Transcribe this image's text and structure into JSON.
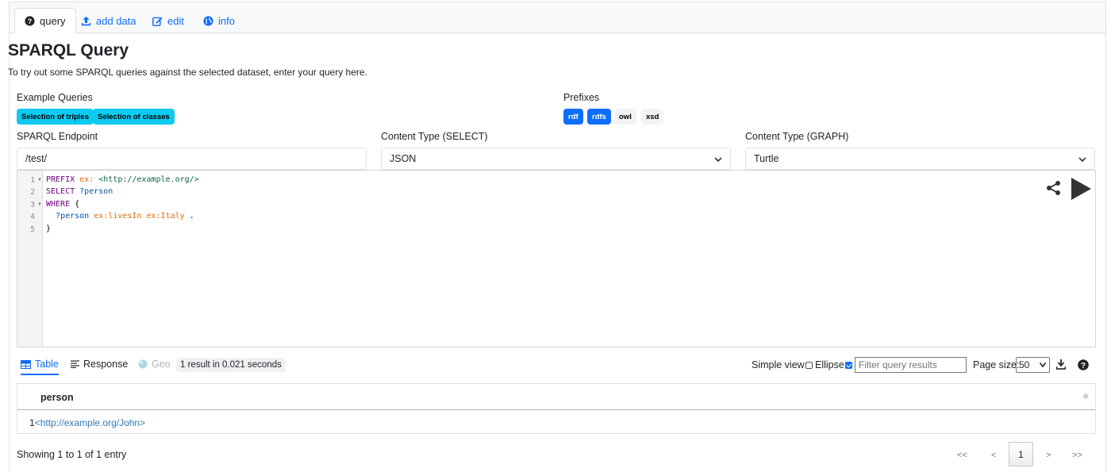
{
  "tabs": [
    {
      "label": "query",
      "icon": "question-circle-icon"
    },
    {
      "label": "add data",
      "icon": "upload-icon"
    },
    {
      "label": "edit",
      "icon": "edit-icon"
    },
    {
      "label": "info",
      "icon": "globe-icon"
    }
  ],
  "page": {
    "title": "SPARQL Query",
    "description": "To try out some SPARQL queries against the selected dataset, enter your query here."
  },
  "examples": {
    "label": "Example Queries",
    "items": [
      "Selection of triples",
      "Selection of classes"
    ]
  },
  "prefixes": {
    "label": "Prefixes",
    "items": [
      {
        "label": "rdf",
        "active": true
      },
      {
        "label": "rdfs",
        "active": true
      },
      {
        "label": "owl",
        "active": false
      },
      {
        "label": "xsd",
        "active": false
      }
    ]
  },
  "endpoint": {
    "label": "SPARQL Endpoint",
    "value": "/test/"
  },
  "content_select": {
    "label": "Content Type (SELECT)",
    "value": "JSON"
  },
  "content_graph": {
    "label": "Content Type (GRAPH)",
    "value": "Turtle"
  },
  "editor": {
    "line_numbers": [
      "1",
      "2",
      "3",
      "4",
      "5"
    ],
    "lines": [
      {
        "t1": "PREFIX",
        "t2": "ex:",
        "t3": "<http://example.org/>"
      },
      {
        "t1": "SELECT",
        "t2": "?person"
      },
      {
        "t1": "WHERE",
        "t2": "{"
      },
      {
        "t1": "?person",
        "t2": "ex:livesIn",
        "t3": "ex:Italy",
        "t4": "."
      },
      {
        "t1": "}"
      }
    ]
  },
  "results": {
    "tabs": [
      "Table",
      "Response",
      "Geo"
    ],
    "summary": "1 result in 0.021 seconds",
    "simple_view_label": "Simple view",
    "simple_view_checked": false,
    "ellipse_label": "Ellipse",
    "ellipse_checked": true,
    "filter_placeholder": "Filter query results",
    "page_size_label": "Page size:",
    "page_size_value": "50",
    "column": "person",
    "row_index": "1",
    "row_value": "<http://example.org/John>",
    "showing": "Showing 1 to 1 of 1 entry",
    "pager": {
      "first": "<<",
      "prev": "<",
      "current": "1",
      "next": ">",
      "last": ">>"
    }
  },
  "colors": {
    "primary": "#0d6efd",
    "info": "#0dcaf0"
  }
}
